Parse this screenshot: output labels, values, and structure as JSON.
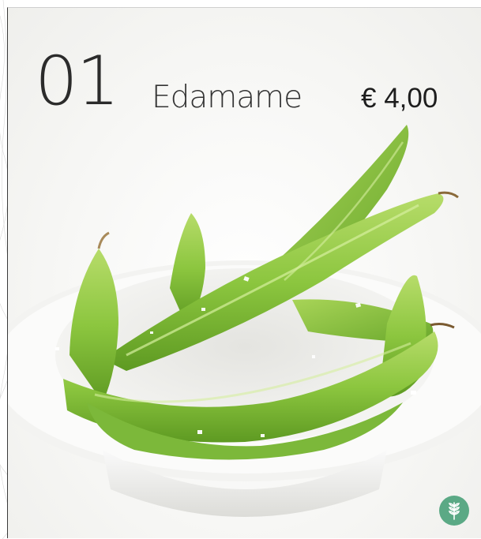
{
  "item": {
    "number": "01",
    "name": "Edamame",
    "price": "€ 4,00"
  },
  "photo": {
    "subject": "edamame-pods-in-white-bowl"
  },
  "badge": {
    "icon": "wheat-icon",
    "color": "#5ba985"
  },
  "colors": {
    "pod_green": "#8cc63f",
    "bowl_white": "#f4f4f2"
  }
}
